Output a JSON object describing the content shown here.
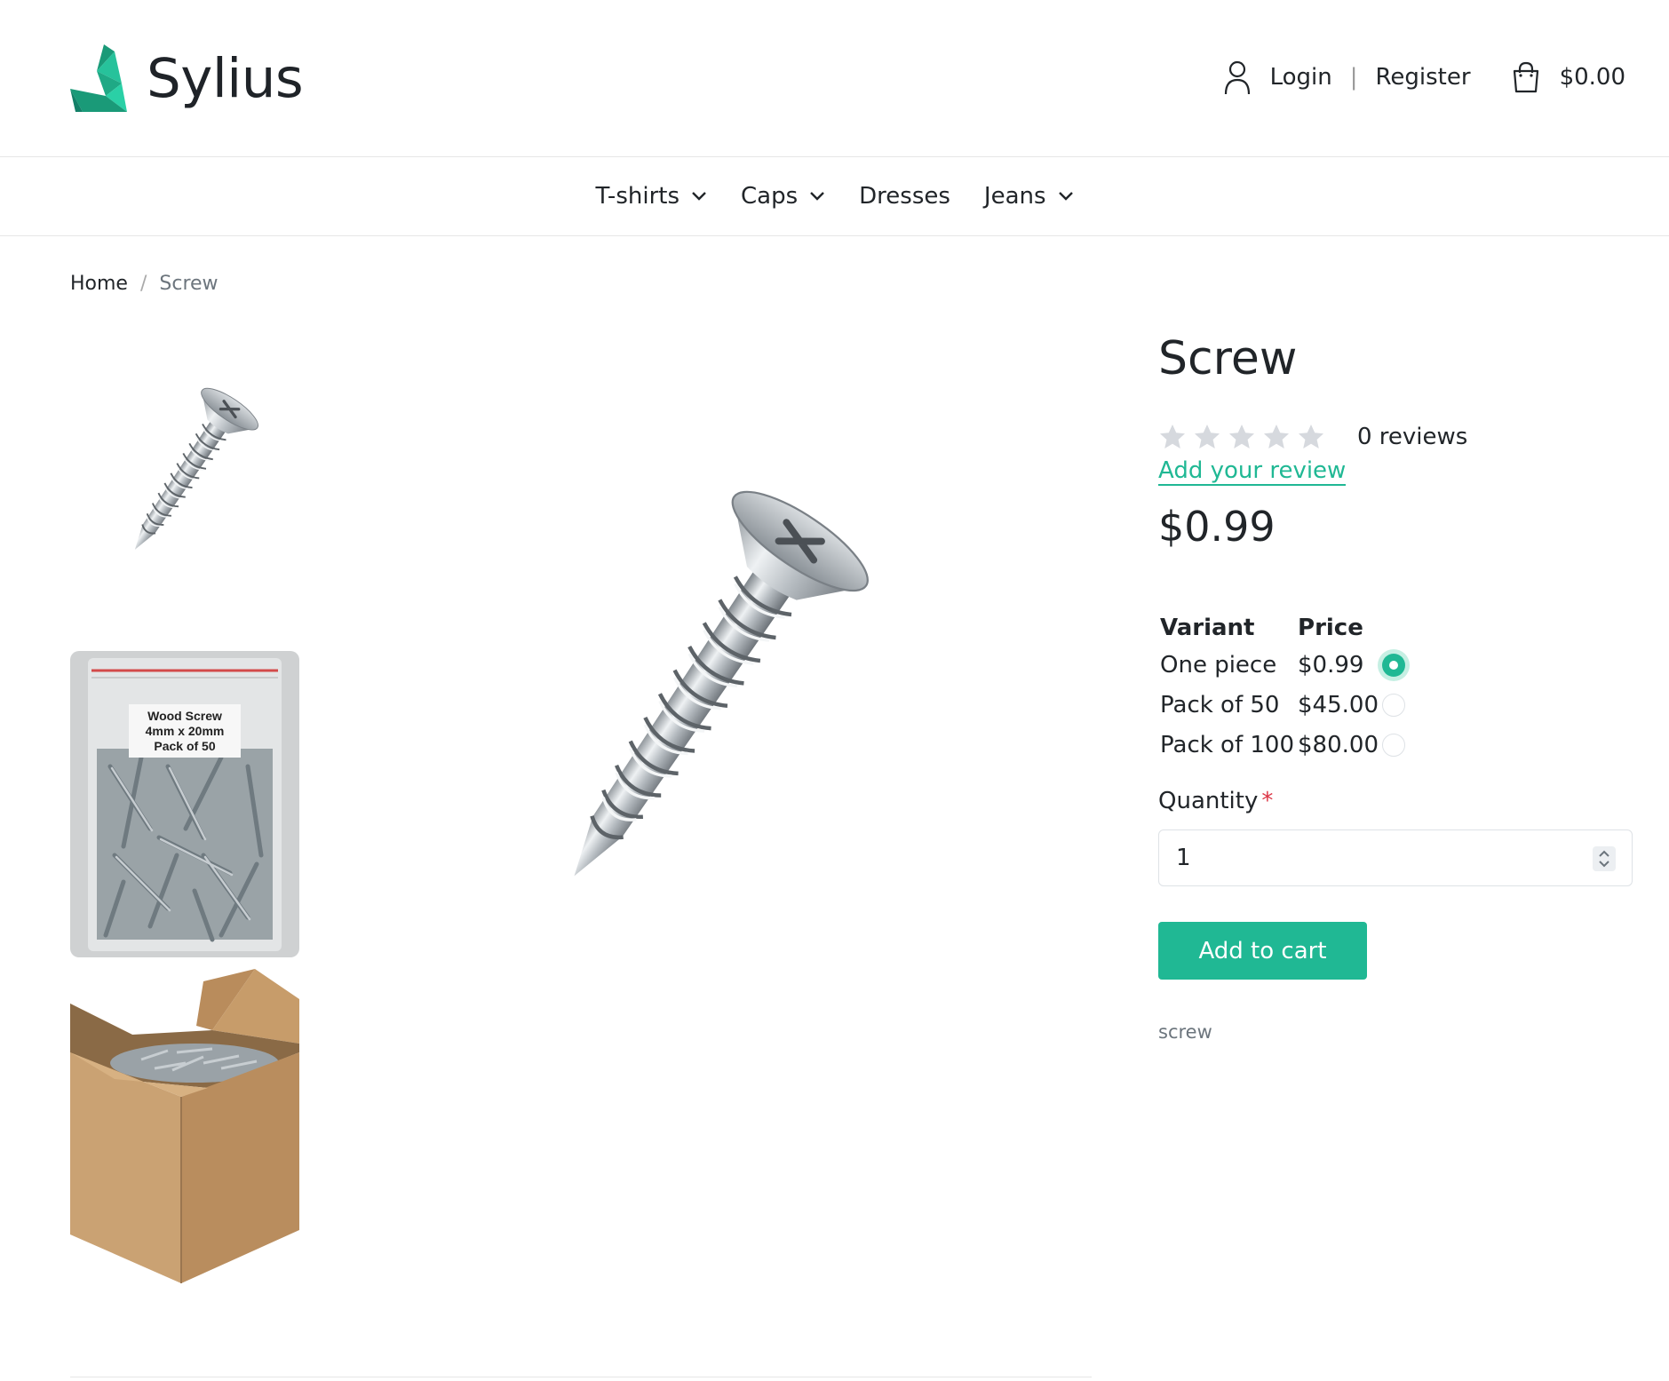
{
  "brand": {
    "name": "Sylius",
    "accent_color": "#20b894"
  },
  "header": {
    "login_label": "Login",
    "divider": "|",
    "register_label": "Register",
    "cart_total": "$0.00",
    "user_icon": "user-icon",
    "cart_icon": "shopping-bag-icon"
  },
  "nav": {
    "items": [
      {
        "label": "T-shirts",
        "has_dropdown": true
      },
      {
        "label": "Caps",
        "has_dropdown": true
      },
      {
        "label": "Dresses",
        "has_dropdown": false
      },
      {
        "label": "Jeans",
        "has_dropdown": true
      }
    ]
  },
  "breadcrumb": {
    "home": "Home",
    "separator": "/",
    "current": "Screw"
  },
  "gallery": {
    "package_label": [
      "Wood Screw",
      "4mm x 20mm",
      "Pack of 50"
    ]
  },
  "product": {
    "title": "Screw",
    "rating": 0,
    "rating_max": 5,
    "reviews_count": "0 reviews",
    "add_review": "Add your review",
    "price": "$0.99",
    "variant_header": "Variant",
    "price_header": "Price",
    "variants": [
      {
        "name": "One piece",
        "price": "$0.99",
        "selected": true
      },
      {
        "name": "Pack of 50",
        "price": "$45.00",
        "selected": false
      },
      {
        "name": "Pack of 100",
        "price": "$80.00",
        "selected": false
      }
    ],
    "quantity_label": "Quantity",
    "required_mark": "*",
    "quantity_value": "1",
    "add_to_cart": "Add to cart",
    "tag": "screw"
  }
}
